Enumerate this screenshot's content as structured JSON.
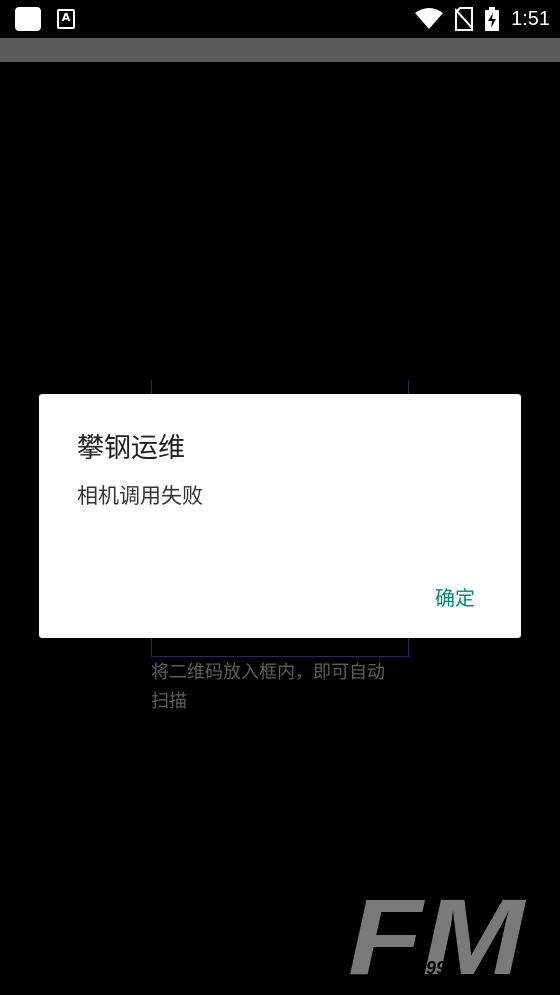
{
  "status_bar": {
    "time": "1:51",
    "notification_icons": [
      "app-square-icon",
      "a-letter-icon"
    ],
    "notification_a_letter": "A",
    "system_icons": [
      "wifi-icon",
      "no-sim-icon",
      "battery-charging-icon"
    ]
  },
  "scanner": {
    "hint_line1": "将二维码放入框内，即可自动",
    "hint_line2": "扫描"
  },
  "dialog": {
    "title": "攀钢运维",
    "message": "相机调用失败",
    "ok_label": "确定"
  },
  "watermark": {
    "text": "FM",
    "subtext": "4399"
  },
  "colors": {
    "accent": "#00897b",
    "app_bar": "#5a5a5a",
    "background": "#000000"
  }
}
